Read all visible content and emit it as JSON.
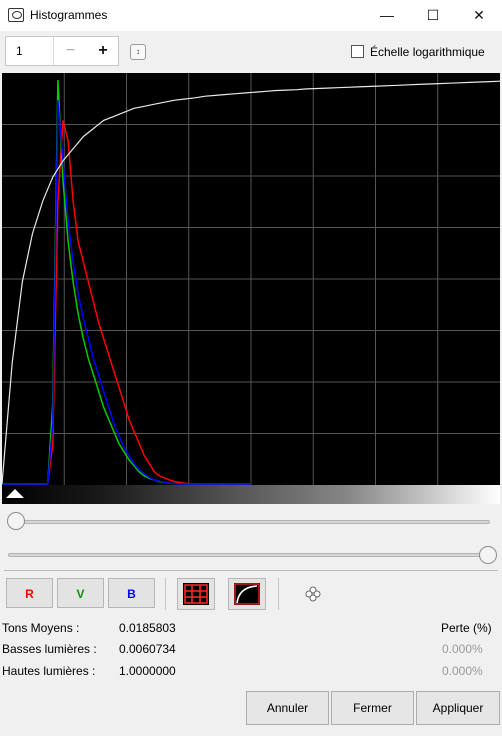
{
  "window": {
    "title": "Histogrammes",
    "minimize_glyph": "—",
    "maximize_glyph": "☐",
    "close_glyph": "✕"
  },
  "toolbar": {
    "spin_value": "1",
    "minus_label": "−",
    "plus_label": "+",
    "log_scale_label": "Échelle logarithmique",
    "log_scale_checked": false
  },
  "channels": {
    "r_label": "R",
    "v_label": "V",
    "b_label": "B",
    "r_color": "#ff0000",
    "v_color": "#009900",
    "b_color": "#0000ff"
  },
  "icons": {
    "grid_icon": "grid-icon",
    "curve_icon": "curve-icon",
    "stack_icon": "layers-icon"
  },
  "stats": {
    "tons_moyens_label": "Tons Moyens :",
    "tons_moyens_value": "0.0185803",
    "basses_label": "Basses lumières :",
    "basses_value": "0.0060734",
    "hautes_label": "Hautes lumières :",
    "hautes_value": "1.0000000",
    "perte_header": "Perte (%)",
    "basses_perte": "0.000%",
    "hautes_perte": "0.000%"
  },
  "buttons": {
    "annuler": "Annuler",
    "fermer": "Fermer",
    "appliquer": "Appliquer"
  },
  "sliders": {
    "low_value": 0.0,
    "high_value": 1.0
  },
  "chart_data": {
    "type": "line",
    "grid": true,
    "series": [
      {
        "color": "#ff0000",
        "values": [
          0,
          0,
          0,
          0,
          0,
          0,
          0,
          0,
          0,
          0,
          0.1,
          0.7,
          0.9,
          0.85,
          0.7,
          0.6,
          0.55,
          0.5,
          0.45,
          0.4,
          0.36,
          0.32,
          0.28,
          0.24,
          0.2,
          0.16,
          0.13,
          0.1,
          0.07,
          0.05,
          0.03,
          0.02,
          0.015,
          0.01,
          0.006,
          0.004,
          0.002,
          0.001,
          0,
          0,
          0,
          0,
          0,
          0,
          0,
          0,
          0,
          0,
          0,
          0
        ]
      },
      {
        "color": "#00cc00",
        "values": [
          0,
          0,
          0,
          0,
          0,
          0,
          0,
          0,
          0,
          0,
          0.2,
          1.0,
          0.75,
          0.6,
          0.5,
          0.42,
          0.36,
          0.31,
          0.27,
          0.23,
          0.19,
          0.16,
          0.13,
          0.1,
          0.08,
          0.06,
          0.045,
          0.03,
          0.02,
          0.014,
          0.01,
          0.006,
          0.004,
          0.002,
          0.001,
          0,
          0,
          0,
          0,
          0,
          0,
          0,
          0,
          0,
          0,
          0,
          0,
          0,
          0,
          0
        ]
      },
      {
        "color": "#0000ff",
        "values": [
          0,
          0,
          0,
          0,
          0,
          0,
          0,
          0,
          0,
          0,
          0.15,
          0.95,
          0.8,
          0.65,
          0.55,
          0.47,
          0.41,
          0.36,
          0.31,
          0.27,
          0.23,
          0.19,
          0.15,
          0.12,
          0.09,
          0.07,
          0.05,
          0.035,
          0.025,
          0.016,
          0.01,
          0.007,
          0.004,
          0.002,
          0.001,
          0,
          0,
          0,
          0,
          0,
          0,
          0,
          0,
          0,
          0,
          0,
          0,
          0,
          0,
          0
        ]
      },
      {
        "color": "#e8e8e8",
        "values": [
          0,
          0.3,
          0.5,
          0.62,
          0.7,
          0.76,
          0.8,
          0.83,
          0.86,
          0.88,
          0.9,
          0.91,
          0.92,
          0.93,
          0.935,
          0.94,
          0.945,
          0.95,
          0.953,
          0.956,
          0.96,
          0.962,
          0.964,
          0.966,
          0.968,
          0.97,
          0.972,
          0.974,
          0.975,
          0.976,
          0.978,
          0.979,
          0.98,
          0.981,
          0.982,
          0.983,
          0.984,
          0.985,
          0.986,
          0.987,
          0.988,
          0.989,
          0.99,
          0.991,
          0.992,
          0.993,
          0.994,
          0.995,
          0.996,
          0.997
        ]
      }
    ]
  }
}
